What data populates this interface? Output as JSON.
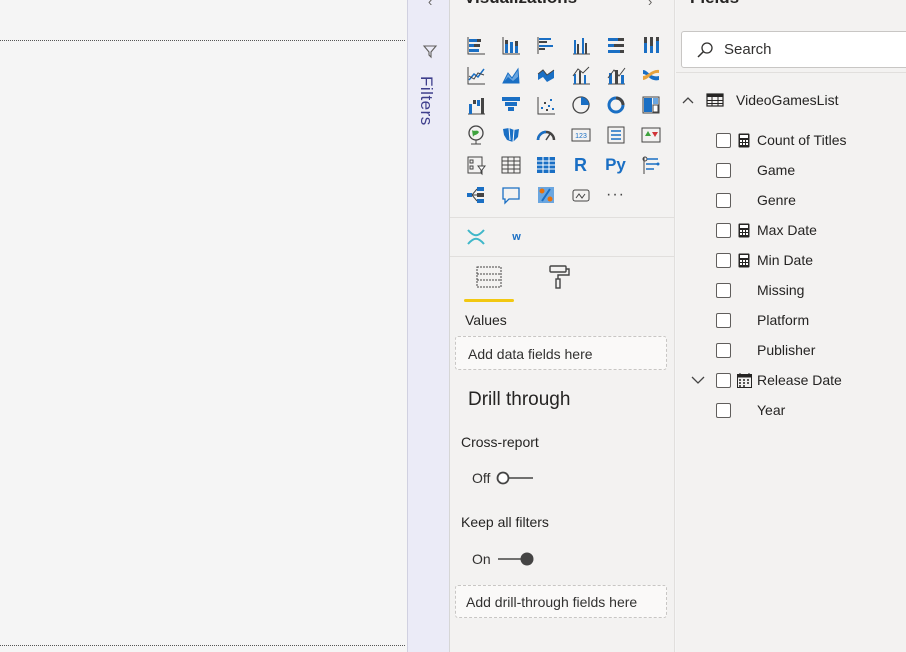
{
  "viz_pane": {
    "title": "Visualizations",
    "values_label": "Values",
    "values_drop_placeholder": "Add data fields here",
    "drill_title": "Drill through",
    "cross_report_label": "Cross-report",
    "cross_report_state": "Off",
    "keep_filters_label": "Keep all filters",
    "keep_filters_state": "On",
    "drill_drop_placeholder": "Add drill-through fields here",
    "more_glyph": "···",
    "r_glyph": "R",
    "py_glyph": "Py",
    "w_glyph": "w"
  },
  "filters_pane": {
    "label": "Filters"
  },
  "fields_pane": {
    "title": "Fields",
    "search_placeholder": "Search",
    "table_name": "VideoGamesList",
    "fields": [
      {
        "name": "Count of Titles",
        "icon": "calculator-icon"
      },
      {
        "name": "Game",
        "icon": ""
      },
      {
        "name": "Genre",
        "icon": ""
      },
      {
        "name": "Max Date",
        "icon": "calculator-icon"
      },
      {
        "name": "Min Date",
        "icon": "calculator-icon"
      },
      {
        "name": "Missing",
        "icon": ""
      },
      {
        "name": "Platform",
        "icon": ""
      },
      {
        "name": "Publisher",
        "icon": ""
      },
      {
        "name": "Release Date",
        "icon": "calendar-icon"
      },
      {
        "name": "Year",
        "icon": ""
      }
    ]
  },
  "colors": {
    "accent_blue": "#1a6fc4",
    "tab_underline": "#f2c811",
    "filters_text": "#3e3e8c"
  }
}
